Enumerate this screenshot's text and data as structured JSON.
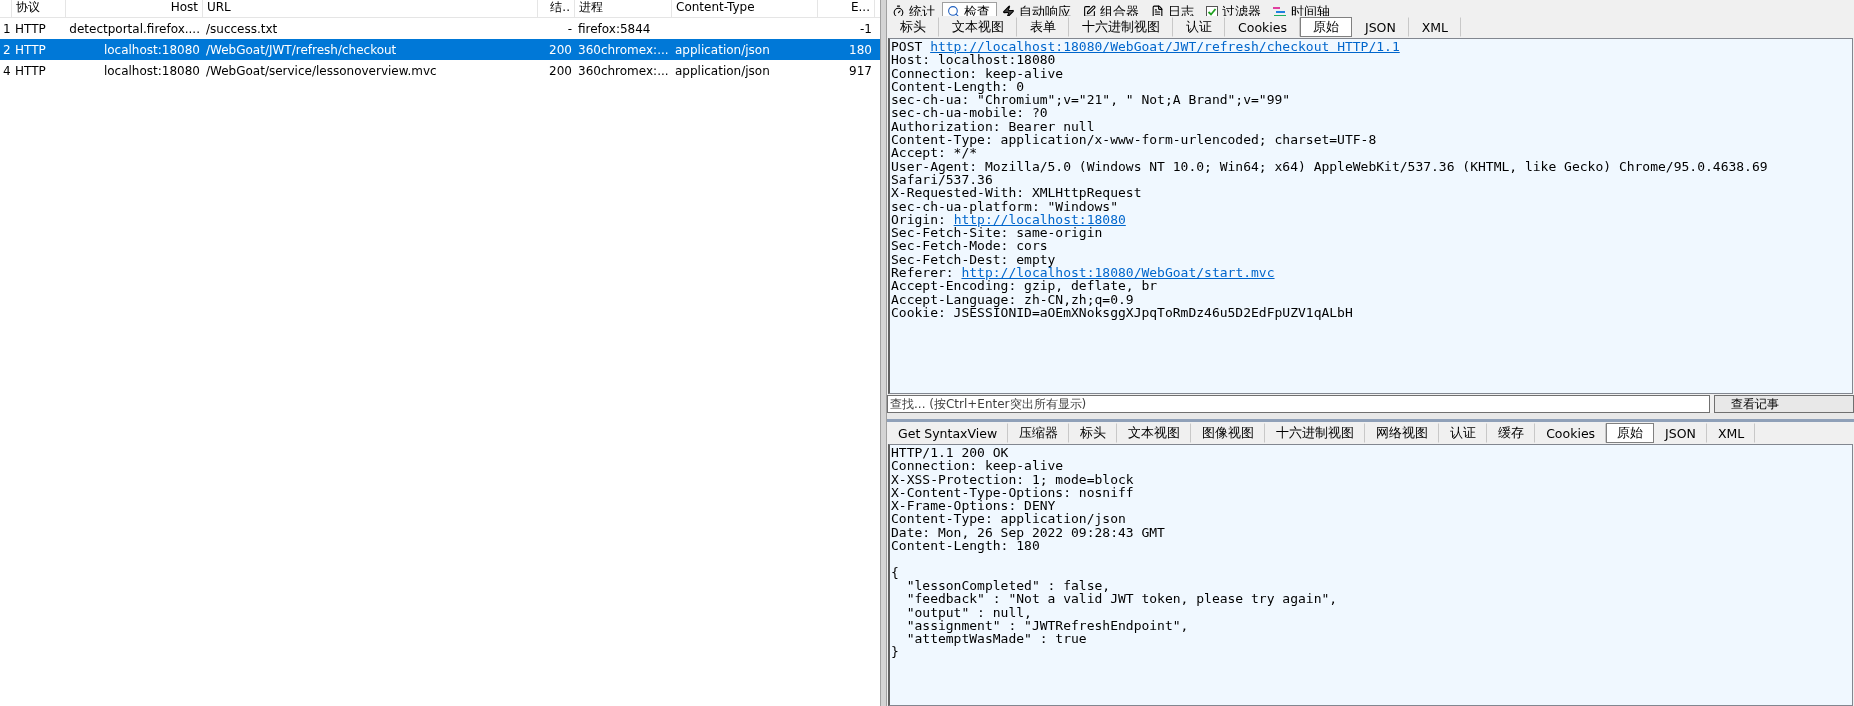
{
  "sessions": {
    "columns": [
      "协议",
      "Host",
      "URL",
      "结..",
      "进程",
      "Content-Type",
      "E..."
    ],
    "rows": [
      {
        "number": "1",
        "protocol": "HTTP",
        "host": "detectportal.firefox....",
        "url": "/success.txt",
        "result": "-",
        "process": "firefox:5844",
        "body": "-1",
        "selected": false
      },
      {
        "number": "2",
        "protocol": "HTTP",
        "host": "localhost:18080",
        "url": "/WebGoat/JWT/refresh/checkout",
        "result": "200",
        "process": "360chromex:...",
        "content_type": "application/json",
        "body": "180",
        "selected": true
      },
      {
        "number": "4",
        "protocol": "HTTP",
        "host": "localhost:18080",
        "url": "/WebGoat/service/lessonoverview.mvc",
        "result": "200",
        "process": "360chromex:...",
        "content_type": "application/json",
        "body": "917",
        "selected": false
      }
    ]
  },
  "toolbar": {
    "tabs": [
      {
        "label": "统计",
        "kind": "timer",
        "selected": false
      },
      {
        "label": "检查",
        "kind": "inspect",
        "selected": true
      },
      {
        "label": "自动响应",
        "kind": "bolt",
        "selected": false
      },
      {
        "label": "组合器",
        "kind": "compose",
        "selected": false
      },
      {
        "label": "日志",
        "kind": "log",
        "selected": false
      },
      {
        "label": "过滤器",
        "kind": "checkbox",
        "checked": true,
        "selected": false
      },
      {
        "label": "时间轴",
        "kind": "timeline",
        "selected": false
      }
    ]
  },
  "request": {
    "tabs": [
      {
        "label": "标头",
        "selected": false
      },
      {
        "label": "文本视图",
        "selected": false
      },
      {
        "label": "表单",
        "selected": false
      },
      {
        "label": "十六进制视图",
        "selected": false
      },
      {
        "label": "认证",
        "selected": false
      },
      {
        "label": "Cookies",
        "selected": false
      },
      {
        "label": "原始",
        "selected": true
      },
      {
        "label": "JSON",
        "selected": false
      },
      {
        "label": "XML",
        "selected": false
      }
    ],
    "lines": [
      {
        "text": "POST ",
        "link": "http://localhost:18080/WebGoat/JWT/refresh/checkout HTTP/1.1"
      },
      {
        "text": "Host: localhost:18080"
      },
      {
        "text": "Connection: keep-alive"
      },
      {
        "text": "Content-Length: 0"
      },
      {
        "text": "sec-ch-ua: \"Chromium\";v=\"21\", \" Not;A Brand\";v=\"99\""
      },
      {
        "text": "sec-ch-ua-mobile: ?0"
      },
      {
        "text": "Authorization: Bearer null"
      },
      {
        "text": "Content-Type: application/x-www-form-urlencoded; charset=UTF-8"
      },
      {
        "text": "Accept: */*"
      },
      {
        "text": "User-Agent: Mozilla/5.0 (Windows NT 10.0; Win64; x64) AppleWebKit/537.36 (KHTML, like Gecko) Chrome/95.0.4638.69"
      },
      {
        "text": "Safari/537.36"
      },
      {
        "text": "X-Requested-With: XMLHttpRequest"
      },
      {
        "text": "sec-ch-ua-platform: \"Windows\""
      },
      {
        "text": "Origin: ",
        "link": "http://localhost:18080"
      },
      {
        "text": "Sec-Fetch-Site: same-origin"
      },
      {
        "text": "Sec-Fetch-Mode: cors"
      },
      {
        "text": "Sec-Fetch-Dest: empty"
      },
      {
        "text": "Referer: ",
        "link": "http://localhost:18080/WebGoat/start.mvc"
      },
      {
        "text": "Accept-Encoding: gzip, deflate, br"
      },
      {
        "text": "Accept-Language: zh-CN,zh;q=0.9"
      },
      {
        "text": "Cookie: JSESSIONID=aOEmXNoksggXJpqToRmDz46u5D2EdFpUZV1qALbH"
      }
    ],
    "find": {
      "placeholder": "查找... (按Ctrl+Enter突出所有显示)",
      "button": "查看记事"
    }
  },
  "response": {
    "tabs": [
      {
        "label": "Get SyntaxView",
        "selected": false
      },
      {
        "label": "压缩器",
        "selected": false
      },
      {
        "label": "标头",
        "selected": false
      },
      {
        "label": "文本视图",
        "selected": false
      },
      {
        "label": "图像视图",
        "selected": false
      },
      {
        "label": "十六进制视图",
        "selected": false
      },
      {
        "label": "网络视图",
        "selected": false
      },
      {
        "label": "认证",
        "selected": false
      },
      {
        "label": "缓存",
        "selected": false
      },
      {
        "label": "Cookies",
        "selected": false
      },
      {
        "label": "原始",
        "selected": true
      },
      {
        "label": "JSON",
        "selected": false
      },
      {
        "label": "XML",
        "selected": false
      }
    ],
    "header_lines": [
      "HTTP/1.1 200 OK",
      "Connection: keep-alive",
      "X-XSS-Protection: 1; mode=block",
      "X-Content-Type-Options: nosniff",
      "X-Frame-Options: DENY",
      "Content-Type: application/json",
      "Date: Mon, 26 Sep 2022 09:28:43 GMT",
      "Content-Length: 180"
    ],
    "body_lines": [
      "{",
      "  \"lessonCompleted\" : false,",
      "  \"feedback\" : \"Not a valid JWT token, please try again\",",
      "  \"output\" : null,",
      "  \"assignment\" : \"JWTRefreshEndpoint\",",
      "  \"attemptWasMade\" : true",
      "}"
    ]
  }
}
